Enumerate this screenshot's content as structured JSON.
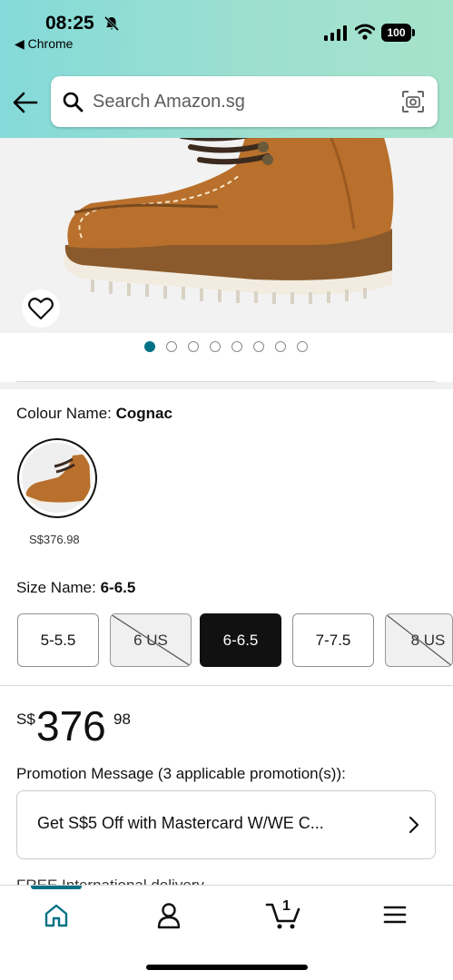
{
  "status_bar": {
    "time": "08:25",
    "back_app": "◀ Chrome",
    "battery": "100"
  },
  "search": {
    "placeholder": "Search Amazon.sg"
  },
  "carousel": {
    "total_images": 8,
    "active_index": 0
  },
  "colour": {
    "label": "Colour Name: ",
    "value": "Cognac",
    "swatch_price": "S$376.98"
  },
  "size": {
    "label": "Size Name: ",
    "value": "6-6.5",
    "options": [
      {
        "label": "5-5.5",
        "state": "available"
      },
      {
        "label": "6 US",
        "state": "unavailable"
      },
      {
        "label": "6-6.5",
        "state": "selected"
      },
      {
        "label": "7-7.5",
        "state": "available"
      },
      {
        "label": "8 US",
        "state": "unavailable"
      }
    ]
  },
  "price": {
    "currency": "S$",
    "whole": "376",
    "fraction": "98"
  },
  "promotion": {
    "heading": "Promotion Message   (3 applicable promotion(s)):",
    "offer_text": "Get S$5 Off with Mastercard W/WE C..."
  },
  "peek_text": "FREE International delivery",
  "bottom_nav": {
    "cart_count": "1",
    "items": [
      "home-icon",
      "account-icon",
      "cart-icon",
      "menu-icon"
    ]
  },
  "colors": {
    "accent": "#007185",
    "header_start": "#84dad9",
    "header_end": "#a6e3cb"
  }
}
